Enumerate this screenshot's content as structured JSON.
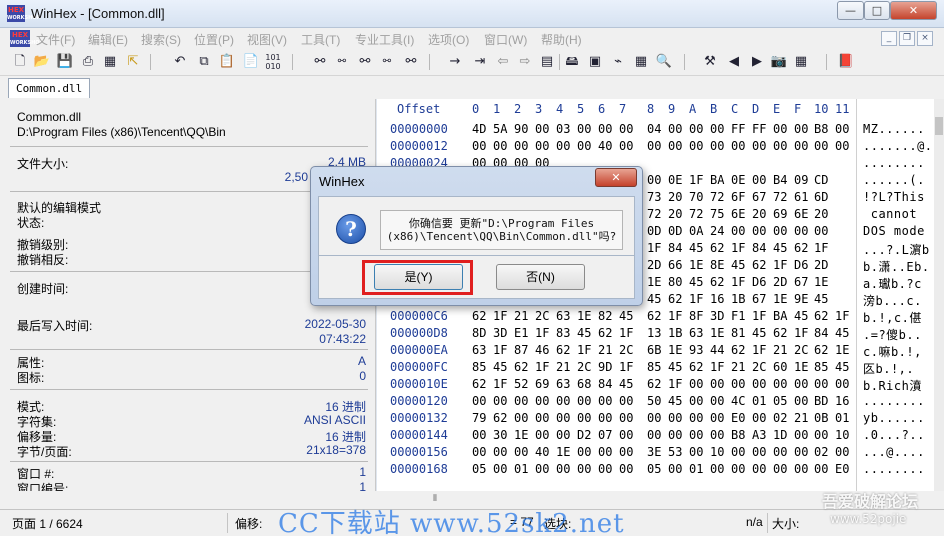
{
  "window": {
    "title": "WinHex - [Common.dll]",
    "logo_top": "HEX",
    "logo_bottom": "WORKSHOP"
  },
  "window_controls": {
    "minimize": "—",
    "maximize": "□",
    "close": "✕"
  },
  "menu": [
    "文件(F)",
    "编辑(E)",
    "搜索(S)",
    "位置(P)",
    "视图(V)",
    "工具(T)",
    "专业工具(I)",
    "选项(O)",
    "窗口(W)",
    "帮助(H)"
  ],
  "mdi_controls": {
    "minimize": "_",
    "restore": "❐",
    "close": "×"
  },
  "toolbar_icons": [
    "new-file",
    "open-folder",
    "save",
    "print",
    "properties",
    "export",
    "undo",
    "copy",
    "paste-clipboard",
    "paste-write",
    "binary-01",
    "find-binoculars",
    "find-hex",
    "replace",
    "replace-hex",
    "find-next",
    "goto-arrow",
    "goto-offset",
    "back",
    "forward",
    "grid",
    "disk-edit",
    "ram-edit",
    "cable",
    "calculator",
    "magnifier",
    "tools-suite",
    "prev",
    "next",
    "camera",
    "table",
    "book"
  ],
  "tab": {
    "label": "Common.dll"
  },
  "info": {
    "filename": "Common.dll",
    "path": "D:\\Program Files (x86)\\Tencent\\QQ\\Bin",
    "file_size_label": "文件大小:",
    "file_size_mb": "2.4 MB",
    "file_size_bytes": "2,50",
    "edit_mode_label": "默认的编辑模式",
    "state_label": "状态:",
    "undo_level_label": "撤销级别:",
    "undo_reverse_label": "撤销相反:",
    "created_label": "创建时间:",
    "created_value": "2",
    "modified_label": "最后写入时间:",
    "modified_date": "2022-05-30",
    "modified_time": "07:43:22",
    "attr_label": "属性:",
    "attr_value": "A",
    "icon_label": "图标:",
    "icon_value": "0",
    "mode_label": "模式:",
    "mode_value": "16 进制",
    "charset_label": "字符集:",
    "charset_value": "ANSI ASCII",
    "offset_label": "偏移量:",
    "offset_value": "16 进制",
    "bytes_page_label": "字节/页面:",
    "bytes_page_value": "21x18=378",
    "window_num_label": "窗口 #:",
    "window_num_value": "1",
    "window_count_label": "窗口编号:",
    "window_count_value": "1"
  },
  "hex": {
    "header_label": "Offset",
    "columns": [
      "0",
      "1",
      "2",
      "3",
      "4",
      "5",
      "6",
      "7",
      "8",
      "9",
      "A",
      "B",
      "C",
      "D",
      "E",
      "F",
      "10",
      "11"
    ],
    "rows": [
      {
        "offset": "00000000",
        "bytes": [
          "4D",
          "5A",
          "90",
          "00",
          "03",
          "00",
          "00",
          "00",
          "04",
          "00",
          "00",
          "00",
          "FF",
          "FF",
          "00",
          "00",
          "B8",
          "00"
        ],
        "text": "MZ......"
      },
      {
        "offset": "00000012",
        "bytes": [
          "00",
          "00",
          "00",
          "00",
          "00",
          "00",
          "40",
          "00",
          "00",
          "00",
          "00",
          "00",
          "00",
          "00",
          "00",
          "00",
          "00",
          "00"
        ],
        "text": ".......@."
      },
      {
        "offset": "00000024",
        "bytes": [
          "00",
          "00",
          "00",
          "00",
          "",
          "",
          "",
          "",
          "",
          "",
          "",
          "",
          "",
          "",
          "",
          "",
          "",
          ""
        ],
        "text": "........"
      },
      {
        "offset": "00000036",
        "bytes": [
          "",
          "",
          "",
          "",
          "",
          "",
          "",
          "",
          "00",
          "0E",
          "1F",
          "BA",
          "0E",
          "00",
          "B4",
          "09",
          "CD",
          ""
        ],
        "text": "......(."
      },
      {
        "offset": "00000048",
        "bytes": [
          "",
          "",
          "",
          "",
          "",
          "",
          "",
          "",
          "73",
          "20",
          "70",
          "72",
          "6F",
          "67",
          "72",
          "61",
          "6D",
          ""
        ],
        "text": "!?L?This"
      },
      {
        "offset": "0000005A",
        "bytes": [
          "",
          "",
          "",
          "",
          "",
          "",
          "",
          "",
          "72",
          "20",
          "72",
          "75",
          "6E",
          "20",
          "69",
          "6E",
          "20",
          ""
        ],
        "text": " cannot"
      },
      {
        "offset": "0000006C",
        "bytes": [
          "",
          "",
          "",
          "",
          "",
          "",
          "",
          "",
          "0D",
          "0D",
          "0A",
          "24",
          "00",
          "00",
          "00",
          "00",
          "00",
          ""
        ],
        "text": "DOS mode"
      },
      {
        "offset": "0000007E",
        "bytes": [
          "",
          "",
          "",
          "",
          "",
          "",
          "",
          "",
          "1F",
          "84",
          "45",
          "62",
          "1F",
          "84",
          "45",
          "62",
          "1F",
          ""
        ],
        "text": "...?.L濵b"
      },
      {
        "offset": "00000090",
        "bytes": [
          "",
          "",
          "",
          "",
          "",
          "",
          "",
          "",
          "2D",
          "66",
          "1E",
          "8E",
          "45",
          "62",
          "1F",
          "D6",
          "2D",
          ""
        ],
        "text": "b.潇..Eb."
      },
      {
        "offset": "000000A2",
        "bytes": [
          "",
          "",
          "",
          "",
          "",
          "",
          "",
          "",
          "1E",
          "80",
          "45",
          "62",
          "1F",
          "D6",
          "2D",
          "67",
          "1E",
          ""
        ],
        "text": "a.瓛b.?c"
      },
      {
        "offset": "000000B4",
        "bytes": [
          "",
          "",
          "",
          "",
          "",
          "",
          "",
          "",
          "45",
          "62",
          "1F",
          "16",
          "1B",
          "67",
          "1E",
          "9E",
          "45",
          ""
        ],
        "text": "滂b...c."
      },
      {
        "offset": "000000C6",
        "bytes": [
          "62",
          "1F",
          "21",
          "2C",
          "63",
          "1E",
          "82",
          "45",
          "62",
          "1F",
          "8F",
          "3D",
          "F1",
          "1F",
          "BA",
          "45",
          "62",
          "1F"
        ],
        "text": "b.!,c.偡"
      },
      {
        "offset": "000000D8",
        "bytes": [
          "8D",
          "3D",
          "E1",
          "1F",
          "83",
          "45",
          "62",
          "1F",
          "13",
          "1B",
          "63",
          "1E",
          "81",
          "45",
          "62",
          "1F",
          "84",
          "45"
        ],
        "text": ".=?傻b.."
      },
      {
        "offset": "000000EA",
        "bytes": [
          "63",
          "1F",
          "87",
          "46",
          "62",
          "1F",
          "21",
          "2C",
          "6B",
          "1E",
          "93",
          "44",
          "62",
          "1F",
          "21",
          "2C",
          "62",
          "1E"
        ],
        "text": "c.嘛b.!,"
      },
      {
        "offset": "000000FC",
        "bytes": [
          "85",
          "45",
          "62",
          "1F",
          "21",
          "2C",
          "9D",
          "1F",
          "85",
          "45",
          "62",
          "1F",
          "21",
          "2C",
          "60",
          "1E",
          "85",
          "45"
        ],
        "text": "匛b.!,."
      },
      {
        "offset": "0000010E",
        "bytes": [
          "62",
          "1F",
          "52",
          "69",
          "63",
          "68",
          "84",
          "45",
          "62",
          "1F",
          "00",
          "00",
          "00",
          "00",
          "00",
          "00",
          "00",
          "00"
        ],
        "text": "b.Rich濆"
      },
      {
        "offset": "00000120",
        "bytes": [
          "00",
          "00",
          "00",
          "00",
          "00",
          "00",
          "00",
          "00",
          "50",
          "45",
          "00",
          "00",
          "4C",
          "01",
          "05",
          "00",
          "BD",
          "16"
        ],
        "text": "........"
      },
      {
        "offset": "00000132",
        "bytes": [
          "79",
          "62",
          "00",
          "00",
          "00",
          "00",
          "00",
          "00",
          "00",
          "00",
          "00",
          "00",
          "E0",
          "00",
          "02",
          "21",
          "0B",
          "01"
        ],
        "text": "yb......"
      },
      {
        "offset": "00000144",
        "bytes": [
          "00",
          "30",
          "1E",
          "00",
          "00",
          "D2",
          "07",
          "00",
          "00",
          "00",
          "00",
          "00",
          "B8",
          "A3",
          "1D",
          "00",
          "00",
          "10"
        ],
        "text": ".0...?.."
      },
      {
        "offset": "00000156",
        "bytes": [
          "00",
          "00",
          "00",
          "40",
          "1E",
          "00",
          "00",
          "00",
          "3E",
          "53",
          "00",
          "10",
          "00",
          "00",
          "00",
          "00",
          "02",
          "00"
        ],
        "text": "...@...."
      },
      {
        "offset": "00000168",
        "bytes": [
          "05",
          "00",
          "01",
          "00",
          "00",
          "00",
          "00",
          "00",
          "05",
          "00",
          "01",
          "00",
          "00",
          "00",
          "00",
          "00",
          "00",
          "E0"
        ],
        "text": "........"
      }
    ]
  },
  "status": {
    "page": "页面 1 / 6624",
    "offset_label": "偏移:",
    "sel_value": "= 77",
    "sel_label": "选块:",
    "na": "n/a",
    "size_label": "大小:"
  },
  "dialog": {
    "title": "WinHex",
    "close": "✕",
    "icon": "?",
    "message_line1": "你确信要 更新\"D:\\Program Files",
    "message_line2": "(x86)\\Tencent\\QQ\\Bin\\Common.dll\"吗?",
    "yes_label": "是(Y)",
    "no_label": "否(N)"
  },
  "watermarks": {
    "site": "CC下载站 www.52sk2.net",
    "forum": "吾爱破解论坛",
    "forum_url": "www.52pojie"
  }
}
